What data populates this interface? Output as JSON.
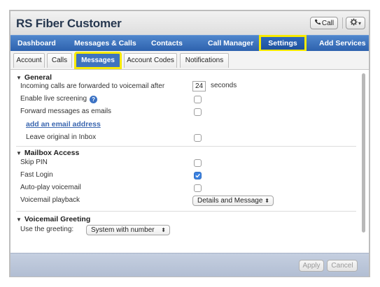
{
  "app": {
    "title": "RS Fiber Customer"
  },
  "header": {
    "call_label": "Call",
    "gear_caret": "▾"
  },
  "nav": {
    "items": [
      {
        "label": "Dashboard"
      },
      {
        "label": "Messages & Calls"
      },
      {
        "label": "Contacts"
      },
      {
        "label": "Call Manager"
      },
      {
        "label": "Settings",
        "active": true
      },
      {
        "label": "Add Services"
      }
    ]
  },
  "tabs": {
    "items": [
      {
        "label": "Account"
      },
      {
        "label": "Calls"
      },
      {
        "label": "Messages",
        "active": true
      },
      {
        "label": "Account Codes"
      },
      {
        "label": "Notifications"
      }
    ]
  },
  "general": {
    "title": "General",
    "forward_label": "Incoming calls are forwarded to voicemail after",
    "forward_value": "24",
    "forward_unit": "seconds",
    "screening_label": "Enable live screening",
    "screening_checked": false,
    "email_label": "Forward messages as emails",
    "email_checked": false,
    "add_email_link": "add an email address",
    "leave_label": "Leave original in Inbox",
    "leave_checked": false
  },
  "mailbox": {
    "title": "Mailbox Access",
    "skip_pin_label": "Skip PIN",
    "skip_pin_checked": false,
    "fast_login_label": "Fast Login",
    "fast_login_checked": true,
    "autoplay_label": "Auto-play voicemail",
    "autoplay_checked": false,
    "playback_label": "Voicemail playback",
    "playback_value": "Details and Message"
  },
  "greeting": {
    "title": "Voicemail Greeting",
    "use_label": "Use the greeting:",
    "use_value": "System with number"
  },
  "footer": {
    "apply_label": "Apply",
    "cancel_label": "Cancel"
  },
  "colors": {
    "nav_blue": "#2e62ae",
    "highlight": "#f7ea00",
    "checkbox_blue": "#3b82e0"
  }
}
